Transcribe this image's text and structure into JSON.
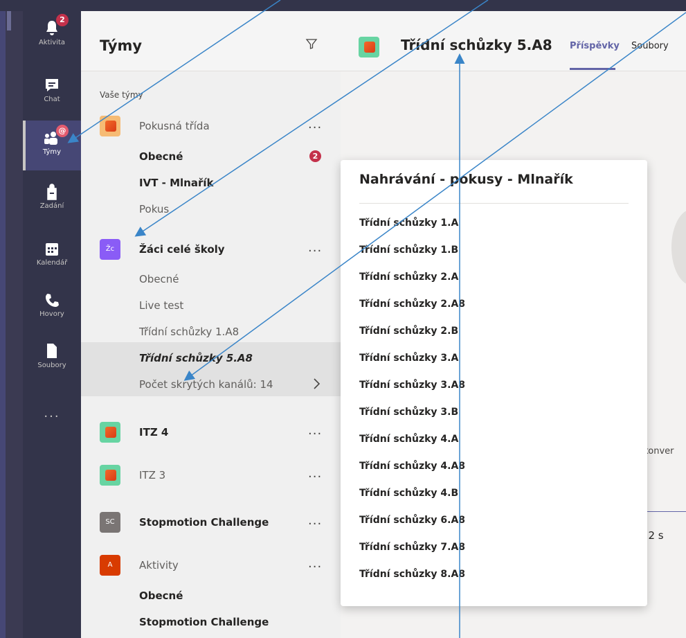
{
  "appbar": {
    "items": [
      {
        "label": "Aktivita",
        "badge": "2",
        "icon": "bell-icon"
      },
      {
        "label": "Chat",
        "icon": "chat-icon"
      },
      {
        "label": "Týmy",
        "badge": "@",
        "icon": "teams-icon"
      },
      {
        "label": "Zadání",
        "icon": "assignments-icon"
      },
      {
        "label": "Kalendář",
        "icon": "calendar-icon"
      },
      {
        "label": "Hovory",
        "icon": "phone-icon"
      },
      {
        "label": "Soubory",
        "icon": "files-icon"
      }
    ],
    "more": "..."
  },
  "teams_panel": {
    "title": "Týmy",
    "section_label": "Vaše týmy",
    "rows": [
      {
        "text": "Pokusná třída",
        "kind": "team",
        "more": "..."
      },
      {
        "text": "Obecné",
        "kind": "channel-bold",
        "badge": "2"
      },
      {
        "text": "IVT - Mlnařík",
        "kind": "channel-bold"
      },
      {
        "text": "Pokus",
        "kind": "channel"
      },
      {
        "text": "Žáci celé školy",
        "kind": "team-bold",
        "avatar_text": "Žc",
        "more": "..."
      },
      {
        "text": "Obecné",
        "kind": "channel"
      },
      {
        "text": "Live test",
        "kind": "channel"
      },
      {
        "text": "Třídní schůzky 1.A8",
        "kind": "channel"
      },
      {
        "text": "Třídní schůzky 5.A8",
        "kind": "channel-selected"
      },
      {
        "text": "Počet skrytých kanálů: 14",
        "kind": "hidden"
      },
      {
        "text": "ITZ 4",
        "kind": "team-bold",
        "more": "..."
      },
      {
        "text": "ITZ 3",
        "kind": "team",
        "more": "..."
      },
      {
        "text": "Stopmotion Challenge",
        "kind": "team-bold",
        "avatar_text": "SC",
        "more": "..."
      },
      {
        "text": "Aktivity",
        "kind": "team",
        "avatar_text": "A",
        "more": "..."
      },
      {
        "text": "Obecné",
        "kind": "channel-bold"
      },
      {
        "text": "Stopmotion Challenge",
        "kind": "channel-bold"
      }
    ]
  },
  "main": {
    "title": "Třídní schůzky 5.A8",
    "tabs": [
      "Příspěvky",
      "Soubory"
    ],
    "snippet1": "t konver",
    "snippet2": "in 2 s"
  },
  "flyout": {
    "title": "Nahrávání - pokusy - Mlnařík",
    "items": [
      "Třídní schůzky 1.A",
      "Třídní schůzky 1.B",
      "Třídní schůzky 2.A",
      "Třídní schůzky 2.A8",
      "Třídní schůzky 2.B",
      "Třídní schůzky 3.A",
      "Třídní schůzky 3.A8",
      "Třídní schůzky 3.B",
      "Třídní schůzky 4.A",
      "Třídní schůzky 4.A8",
      "Třídní schůzky 4.B",
      "Třídní schůzky 6.A8",
      "Třídní schůzky 7.A8",
      "Třídní schůzky 8.A8"
    ]
  },
  "colors": {
    "accent": "#6264a7",
    "appbar": "#33344a",
    "badge": "#c4314b",
    "arrow": "#3a85c8"
  }
}
